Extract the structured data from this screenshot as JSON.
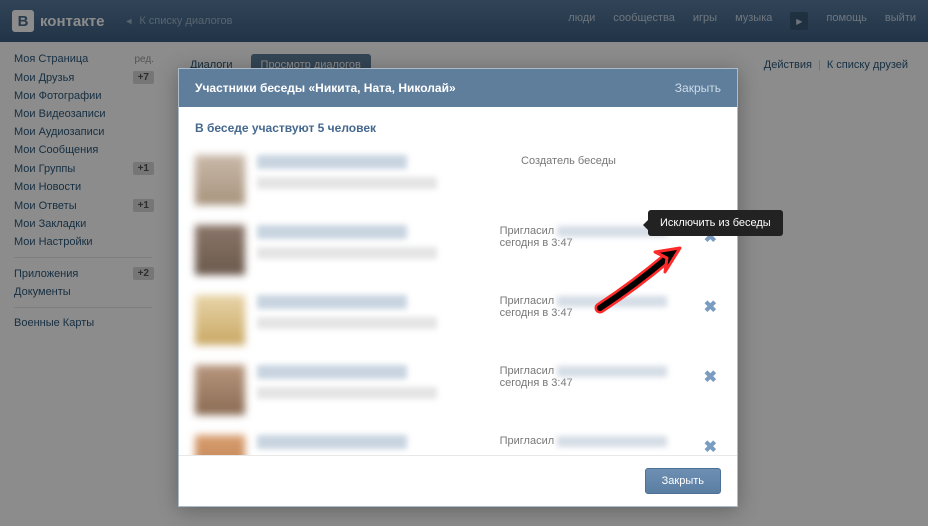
{
  "header": {
    "logo_text": "контакте",
    "logo_letter": "В",
    "back_link": "К списку диалогов",
    "nav": [
      "люди",
      "сообщества",
      "игры",
      "музыка"
    ],
    "nav_right": [
      "помощь",
      "выйти"
    ]
  },
  "sidebar": {
    "items": [
      {
        "label": "Моя Страница",
        "suffix": "ред.",
        "suffix_type": "edit"
      },
      {
        "label": "Мои Друзья",
        "suffix": "+7",
        "suffix_type": "badge"
      },
      {
        "label": "Мои Фотографии"
      },
      {
        "label": "Мои Видеозаписи"
      },
      {
        "label": "Мои Аудиозаписи"
      },
      {
        "label": "Мои Сообщения"
      },
      {
        "label": "Мои Группы",
        "suffix": "+1",
        "suffix_type": "badge"
      },
      {
        "label": "Мои Новости"
      },
      {
        "label": "Мои Ответы",
        "suffix": "+1",
        "suffix_type": "badge"
      },
      {
        "label": "Мои Закладки"
      },
      {
        "label": "Мои Настройки"
      }
    ],
    "items2": [
      {
        "label": "Приложения",
        "suffix": "+2",
        "suffix_type": "badge"
      },
      {
        "label": "Документы"
      }
    ],
    "items3": [
      {
        "label": "Военные Карты"
      }
    ]
  },
  "main": {
    "tabs": [
      {
        "label": "Диалоги",
        "active": false
      },
      {
        "label": "Просмотр диалогов",
        "active": true
      }
    ],
    "actions": {
      "action1": "Действия",
      "divider": "|",
      "action2": "К списку друзей"
    }
  },
  "modal": {
    "title": "Участники беседы «Никита, Ната, Николай»",
    "close_label": "Закрыть",
    "subtitle": "В беседе участвуют 5 человек",
    "creator_label": "Создатель беседы",
    "invited_prefix": "Пригласил",
    "invited_time": "сегодня в 3:47",
    "footer_button": "Закрыть"
  },
  "tooltip": {
    "text": "Исключить из беседы"
  }
}
